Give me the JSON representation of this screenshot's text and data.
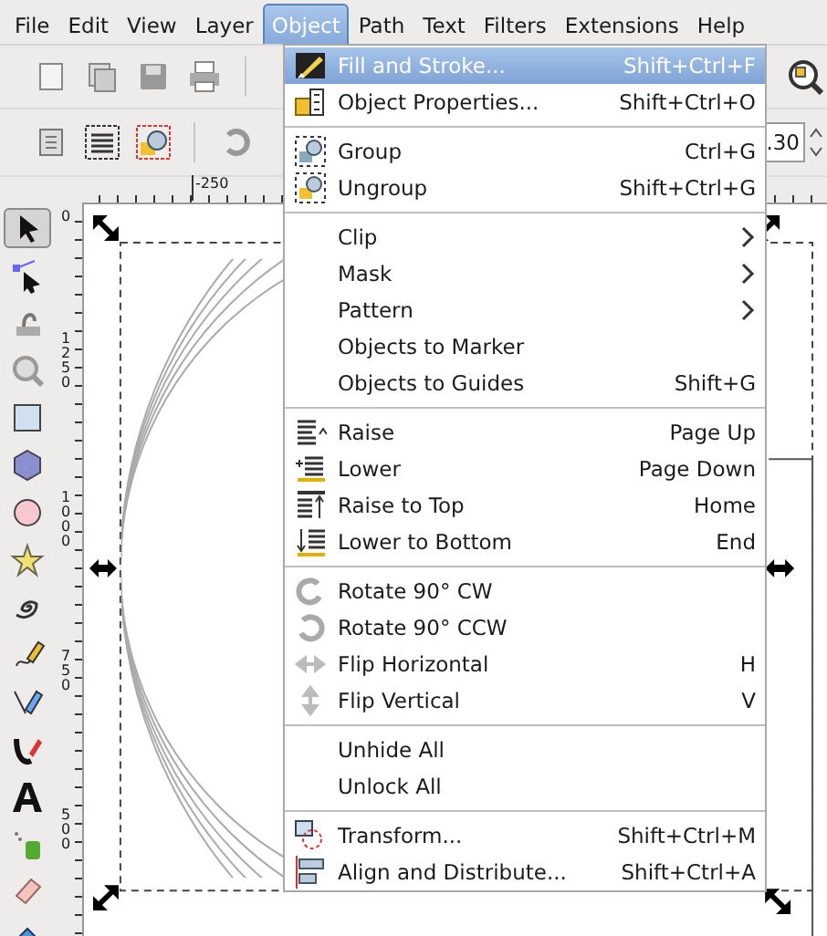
{
  "menubar": [
    {
      "label": "File",
      "selected": false
    },
    {
      "label": "Edit",
      "selected": false
    },
    {
      "label": "View",
      "selected": false
    },
    {
      "label": "Layer",
      "selected": false
    },
    {
      "label": "Object",
      "selected": true
    },
    {
      "label": "Path",
      "selected": false
    },
    {
      "label": "Text",
      "selected": false
    },
    {
      "label": "Filters",
      "selected": false
    },
    {
      "label": "Extensions",
      "selected": false
    },
    {
      "label": "Help",
      "selected": false
    }
  ],
  "zoom_field": {
    "value": ".30"
  },
  "horizontal_ruler": {
    "label": "-250"
  },
  "vertical_ruler": {
    "labels": [
      "0",
      "1250",
      "1000",
      "750",
      "500"
    ]
  },
  "tools": [
    {
      "selected": true
    },
    {
      "selected": false
    },
    {
      "selected": false
    },
    {
      "selected": false
    },
    {
      "selected": false
    },
    {
      "selected": false
    },
    {
      "selected": false
    },
    {
      "selected": false
    },
    {
      "selected": false
    },
    {
      "selected": false
    },
    {
      "selected": false
    },
    {
      "selected": false
    },
    {
      "selected": false
    },
    {
      "selected": false
    },
    {
      "selected": false
    },
    {
      "selected": false
    }
  ],
  "object_menu": {
    "items": [
      {
        "kind": "item",
        "label": "Fill and Stroke...",
        "shortcut": "Shift+Ctrl+F",
        "selected": true
      },
      {
        "kind": "item",
        "label": "Object Properties...",
        "shortcut": "Shift+Ctrl+O",
        "selected": false
      },
      {
        "kind": "separator"
      },
      {
        "kind": "item",
        "label": "Group",
        "shortcut": "Ctrl+G",
        "selected": false
      },
      {
        "kind": "item",
        "label": "Ungroup",
        "shortcut": "Shift+Ctrl+G",
        "selected": false
      },
      {
        "kind": "separator"
      },
      {
        "kind": "submenu",
        "label": "Clip",
        "selected": false
      },
      {
        "kind": "submenu",
        "label": "Mask",
        "selected": false
      },
      {
        "kind": "submenu",
        "label": "Pattern",
        "selected": false
      },
      {
        "kind": "item",
        "label": "Objects to Marker",
        "selected": false
      },
      {
        "kind": "item",
        "label": "Objects to Guides",
        "shortcut": "Shift+G",
        "selected": false
      },
      {
        "kind": "separator"
      },
      {
        "kind": "item",
        "label": "Raise",
        "shortcut": "Page Up",
        "selected": false
      },
      {
        "kind": "item",
        "label": "Lower",
        "shortcut": "Page Down",
        "selected": false
      },
      {
        "kind": "item",
        "label": "Raise to Top",
        "shortcut": "Home",
        "selected": false
      },
      {
        "kind": "item",
        "label": "Lower to Bottom",
        "shortcut": "End",
        "selected": false
      },
      {
        "kind": "separator"
      },
      {
        "kind": "item",
        "label": "Rotate 90° CW",
        "selected": false
      },
      {
        "kind": "item",
        "label": "Rotate 90° CCW",
        "selected": false
      },
      {
        "kind": "item",
        "label": "Flip Horizontal",
        "shortcut": "H",
        "selected": false
      },
      {
        "kind": "item",
        "label": "Flip Vertical",
        "shortcut": "V",
        "selected": false
      },
      {
        "kind": "separator"
      },
      {
        "kind": "item",
        "label": "Unhide All",
        "selected": false
      },
      {
        "kind": "item",
        "label": "Unlock All",
        "selected": false
      },
      {
        "kind": "separator"
      },
      {
        "kind": "item",
        "label": "Transform...",
        "shortcut": "Shift+Ctrl+M",
        "selected": false
      },
      {
        "kind": "item",
        "label": "Align and Distribute...",
        "shortcut": "Shift+Ctrl+A",
        "selected": false
      }
    ]
  }
}
